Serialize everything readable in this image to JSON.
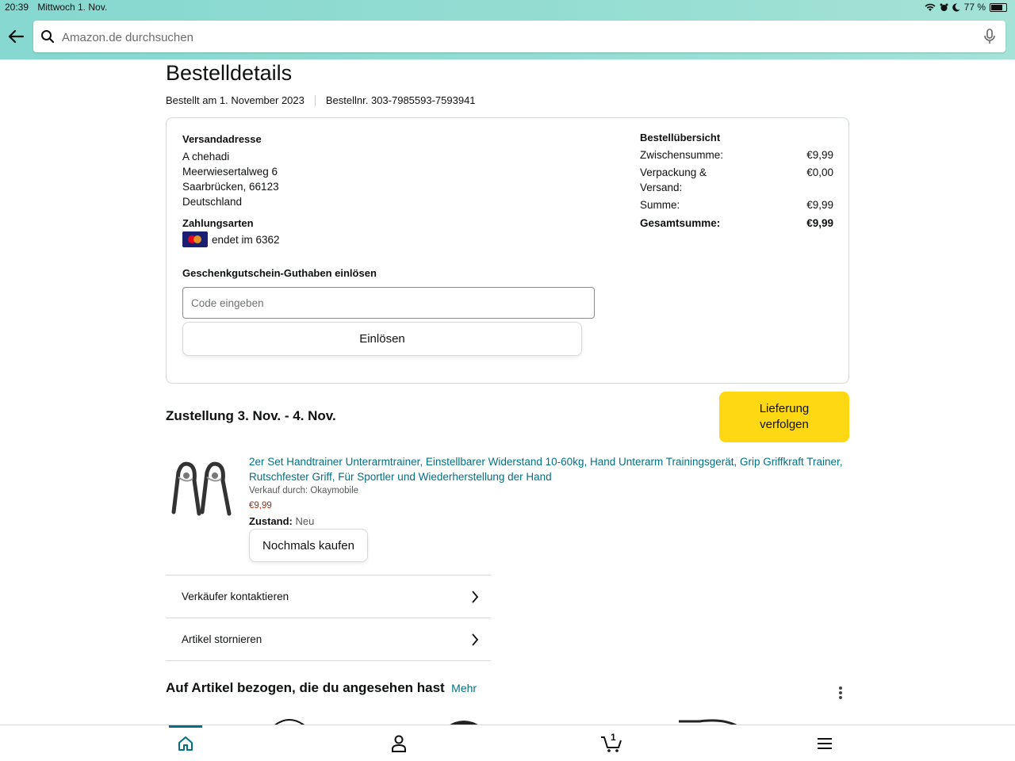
{
  "status_bar": {
    "time": "20:39",
    "date": "Mittwoch 1. Nov.",
    "battery": "77 %",
    "battery_level": 0.77
  },
  "search": {
    "placeholder": "Amazon.de durchsuchen"
  },
  "order": {
    "title": "Bestelldetails",
    "ordered_on": "Bestellt am 1. November 2023",
    "order_number": "Bestellnr. 303-7985593-7593941"
  },
  "shipping": {
    "heading": "Versandadresse",
    "name": "A chehadi",
    "street": "Meerwiesertalweg 6",
    "city": "Saarbrücken, 66123",
    "country": "Deutschland"
  },
  "payment": {
    "heading": "Zahlungsarten",
    "card_text": "endet im 6362",
    "card_icon": "mastercard-icon"
  },
  "gift_card": {
    "heading": "Geschenkgutschein-Guthaben einlösen",
    "input_placeholder": "Code eingeben",
    "redeem_label": "Einlösen"
  },
  "summary": {
    "heading": "Bestellübersicht",
    "subtotal_label": "Zwischensumme:",
    "subtotal_value": "€9,99",
    "shipping_label": "Verpackung & Versand:",
    "shipping_value": "€0,00",
    "sum_label": "Summe:",
    "sum_value": "€9,99",
    "total_label": "Gesamtsumme:",
    "total_value": "€9,99"
  },
  "delivery": {
    "heading": "Zustellung 3. Nov. - 4. Nov.",
    "track_label": "Lieferung verfolgen"
  },
  "product": {
    "title": "2er Set Handtrainer Unterarmtrainer, Einstellbarer Widerstand 10-60kg, Hand Unterarm Trainingsgerät, Grip Griffkraft Trainer, Rutschfester Griff, Für Sportler und Wiederherstellung der Hand",
    "seller": "Verkauf durch: Okaymobile",
    "price": "€9,99",
    "condition_label": "Zustand:",
    "condition_value": "Neu",
    "buy_again_label": "Nochmals kaufen"
  },
  "actions": [
    {
      "label": "Verkäufer kontaktieren"
    },
    {
      "label": "Artikel stornieren"
    }
  ],
  "related": {
    "heading": "Auf Artikel bezogen, die du angesehen hast",
    "more_label": "Mehr"
  },
  "tabbar": {
    "cart_count": "1",
    "active_tab": "home"
  },
  "colors": {
    "link": "#007185",
    "price": "#b12704",
    "primary_button": "#ffd814",
    "header_gradient": "#93dcd2"
  }
}
